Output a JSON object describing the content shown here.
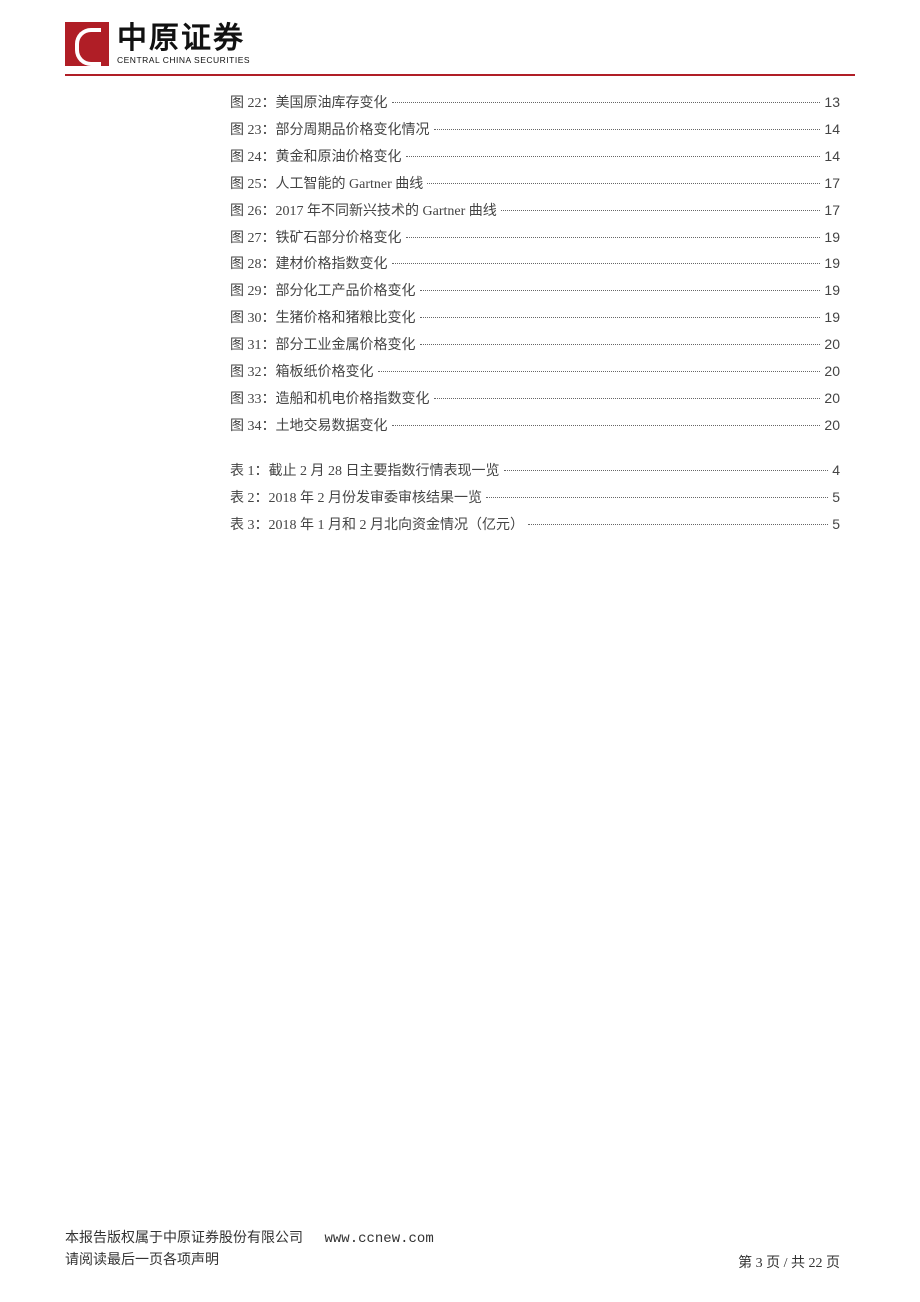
{
  "logo": {
    "cn": "中原证券",
    "en": "CENTRAL CHINA SECURITIES"
  },
  "figures": [
    {
      "label": "图 22：美国原油库存变化",
      "page": "13"
    },
    {
      "label": "图 23：部分周期品价格变化情况",
      "page": "14"
    },
    {
      "label": "图 24：黄金和原油价格变化",
      "page": "14"
    },
    {
      "label": "图 25：人工智能的 Gartner 曲线",
      "page": "17"
    },
    {
      "label": "图 26：2017 年不同新兴技术的 Gartner 曲线",
      "page": "17"
    },
    {
      "label": "图 27：铁矿石部分价格变化",
      "page": "19"
    },
    {
      "label": "图 28：建材价格指数变化",
      "page": "19"
    },
    {
      "label": "图 29：部分化工产品价格变化",
      "page": "19"
    },
    {
      "label": "图 30：生猪价格和猪粮比变化",
      "page": "19"
    },
    {
      "label": "图 31：部分工业金属价格变化",
      "page": "20"
    },
    {
      "label": "图 32：箱板纸价格变化",
      "page": "20"
    },
    {
      "label": "图 33：造船和机电价格指数变化",
      "page": "20"
    },
    {
      "label": "图 34：土地交易数据变化",
      "page": "20"
    }
  ],
  "tables": [
    {
      "label": "表 1：截止 2 月 28 日主要指数行情表现一览",
      "page": "4"
    },
    {
      "label": "表 2：2018 年 2 月份发审委审核结果一览",
      "page": "5"
    },
    {
      "label": "表 3：2018 年 1 月和 2 月北向资金情况（亿元）",
      "page": "5"
    }
  ],
  "footer": {
    "line1_a": "本报告版权属于中原证券股份有限公司",
    "line1_b": "www.ccnew.com",
    "line2": "请阅读最后一页各项声明",
    "pager": "第 3 页  /  共 22 页"
  }
}
